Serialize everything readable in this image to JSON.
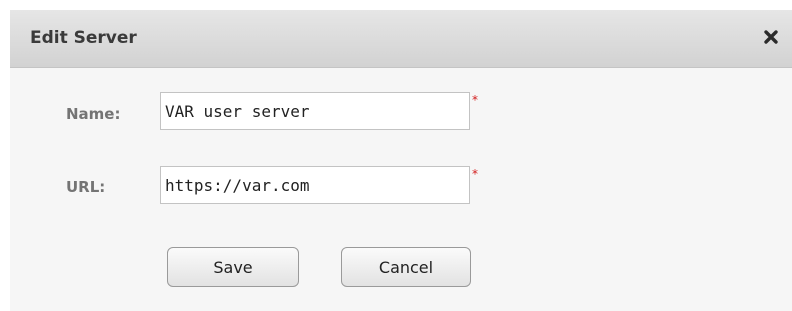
{
  "dialog": {
    "title": "Edit Server",
    "close_icon": "close-icon"
  },
  "form": {
    "name": {
      "label": "Name:",
      "value": "VAR user server",
      "required_mark": "*"
    },
    "url": {
      "label": "URL:",
      "value": "https://var.com",
      "required_mark": "*"
    }
  },
  "buttons": {
    "save_label": "Save",
    "cancel_label": "Cancel"
  },
  "colors": {
    "required": "#d21c1c",
    "title_bar": "#dcdcdc",
    "dialog_bg": "#f6f6f6"
  }
}
